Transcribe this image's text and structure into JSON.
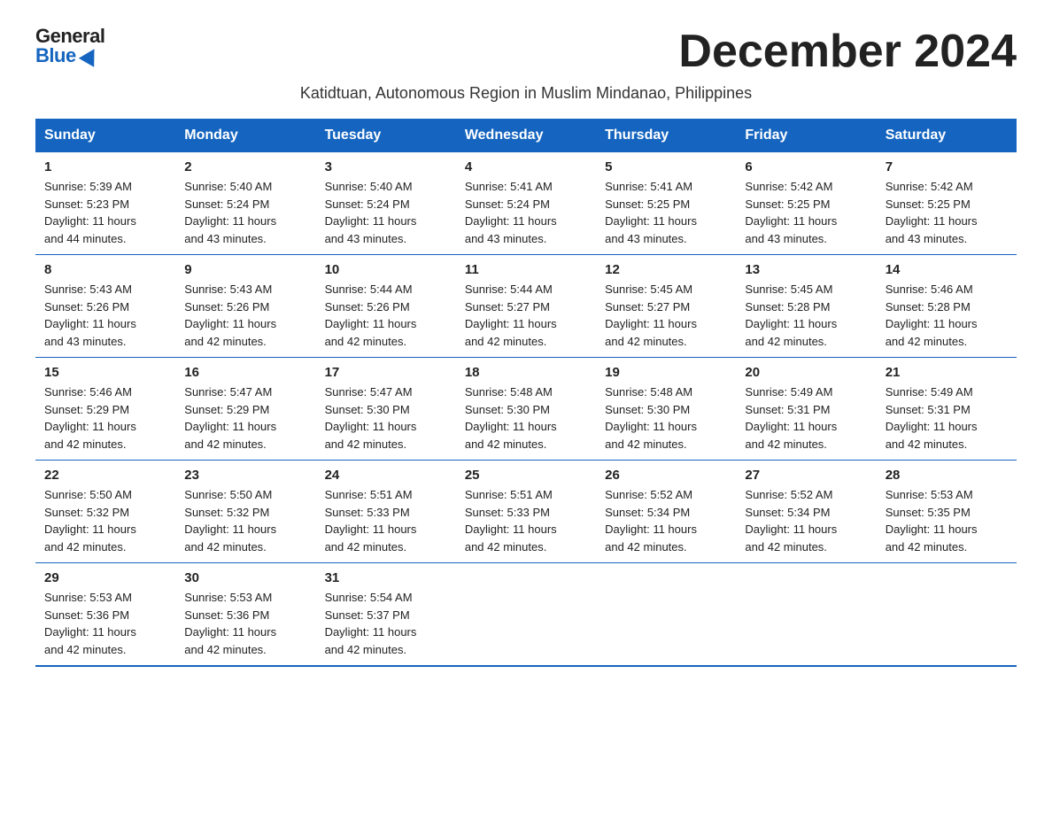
{
  "logo": {
    "general": "General",
    "blue": "Blue"
  },
  "title": "December 2024",
  "subtitle": "Katidtuan, Autonomous Region in Muslim Mindanao, Philippines",
  "days_header": [
    "Sunday",
    "Monday",
    "Tuesday",
    "Wednesday",
    "Thursday",
    "Friday",
    "Saturday"
  ],
  "weeks": [
    [
      {
        "day": "1",
        "sunrise": "5:39 AM",
        "sunset": "5:23 PM",
        "daylight": "11 hours and 44 minutes."
      },
      {
        "day": "2",
        "sunrise": "5:40 AM",
        "sunset": "5:24 PM",
        "daylight": "11 hours and 43 minutes."
      },
      {
        "day": "3",
        "sunrise": "5:40 AM",
        "sunset": "5:24 PM",
        "daylight": "11 hours and 43 minutes."
      },
      {
        "day": "4",
        "sunrise": "5:41 AM",
        "sunset": "5:24 PM",
        "daylight": "11 hours and 43 minutes."
      },
      {
        "day": "5",
        "sunrise": "5:41 AM",
        "sunset": "5:25 PM",
        "daylight": "11 hours and 43 minutes."
      },
      {
        "day": "6",
        "sunrise": "5:42 AM",
        "sunset": "5:25 PM",
        "daylight": "11 hours and 43 minutes."
      },
      {
        "day": "7",
        "sunrise": "5:42 AM",
        "sunset": "5:25 PM",
        "daylight": "11 hours and 43 minutes."
      }
    ],
    [
      {
        "day": "8",
        "sunrise": "5:43 AM",
        "sunset": "5:26 PM",
        "daylight": "11 hours and 43 minutes."
      },
      {
        "day": "9",
        "sunrise": "5:43 AM",
        "sunset": "5:26 PM",
        "daylight": "11 hours and 42 minutes."
      },
      {
        "day": "10",
        "sunrise": "5:44 AM",
        "sunset": "5:26 PM",
        "daylight": "11 hours and 42 minutes."
      },
      {
        "day": "11",
        "sunrise": "5:44 AM",
        "sunset": "5:27 PM",
        "daylight": "11 hours and 42 minutes."
      },
      {
        "day": "12",
        "sunrise": "5:45 AM",
        "sunset": "5:27 PM",
        "daylight": "11 hours and 42 minutes."
      },
      {
        "day": "13",
        "sunrise": "5:45 AM",
        "sunset": "5:28 PM",
        "daylight": "11 hours and 42 minutes."
      },
      {
        "day": "14",
        "sunrise": "5:46 AM",
        "sunset": "5:28 PM",
        "daylight": "11 hours and 42 minutes."
      }
    ],
    [
      {
        "day": "15",
        "sunrise": "5:46 AM",
        "sunset": "5:29 PM",
        "daylight": "11 hours and 42 minutes."
      },
      {
        "day": "16",
        "sunrise": "5:47 AM",
        "sunset": "5:29 PM",
        "daylight": "11 hours and 42 minutes."
      },
      {
        "day": "17",
        "sunrise": "5:47 AM",
        "sunset": "5:30 PM",
        "daylight": "11 hours and 42 minutes."
      },
      {
        "day": "18",
        "sunrise": "5:48 AM",
        "sunset": "5:30 PM",
        "daylight": "11 hours and 42 minutes."
      },
      {
        "day": "19",
        "sunrise": "5:48 AM",
        "sunset": "5:30 PM",
        "daylight": "11 hours and 42 minutes."
      },
      {
        "day": "20",
        "sunrise": "5:49 AM",
        "sunset": "5:31 PM",
        "daylight": "11 hours and 42 minutes."
      },
      {
        "day": "21",
        "sunrise": "5:49 AM",
        "sunset": "5:31 PM",
        "daylight": "11 hours and 42 minutes."
      }
    ],
    [
      {
        "day": "22",
        "sunrise": "5:50 AM",
        "sunset": "5:32 PM",
        "daylight": "11 hours and 42 minutes."
      },
      {
        "day": "23",
        "sunrise": "5:50 AM",
        "sunset": "5:32 PM",
        "daylight": "11 hours and 42 minutes."
      },
      {
        "day": "24",
        "sunrise": "5:51 AM",
        "sunset": "5:33 PM",
        "daylight": "11 hours and 42 minutes."
      },
      {
        "day": "25",
        "sunrise": "5:51 AM",
        "sunset": "5:33 PM",
        "daylight": "11 hours and 42 minutes."
      },
      {
        "day": "26",
        "sunrise": "5:52 AM",
        "sunset": "5:34 PM",
        "daylight": "11 hours and 42 minutes."
      },
      {
        "day": "27",
        "sunrise": "5:52 AM",
        "sunset": "5:34 PM",
        "daylight": "11 hours and 42 minutes."
      },
      {
        "day": "28",
        "sunrise": "5:53 AM",
        "sunset": "5:35 PM",
        "daylight": "11 hours and 42 minutes."
      }
    ],
    [
      {
        "day": "29",
        "sunrise": "5:53 AM",
        "sunset": "5:36 PM",
        "daylight": "11 hours and 42 minutes."
      },
      {
        "day": "30",
        "sunrise": "5:53 AM",
        "sunset": "5:36 PM",
        "daylight": "11 hours and 42 minutes."
      },
      {
        "day": "31",
        "sunrise": "5:54 AM",
        "sunset": "5:37 PM",
        "daylight": "11 hours and 42 minutes."
      },
      null,
      null,
      null,
      null
    ]
  ],
  "sunrise_label": "Sunrise:",
  "sunset_label": "Sunset:",
  "daylight_label": "Daylight:"
}
